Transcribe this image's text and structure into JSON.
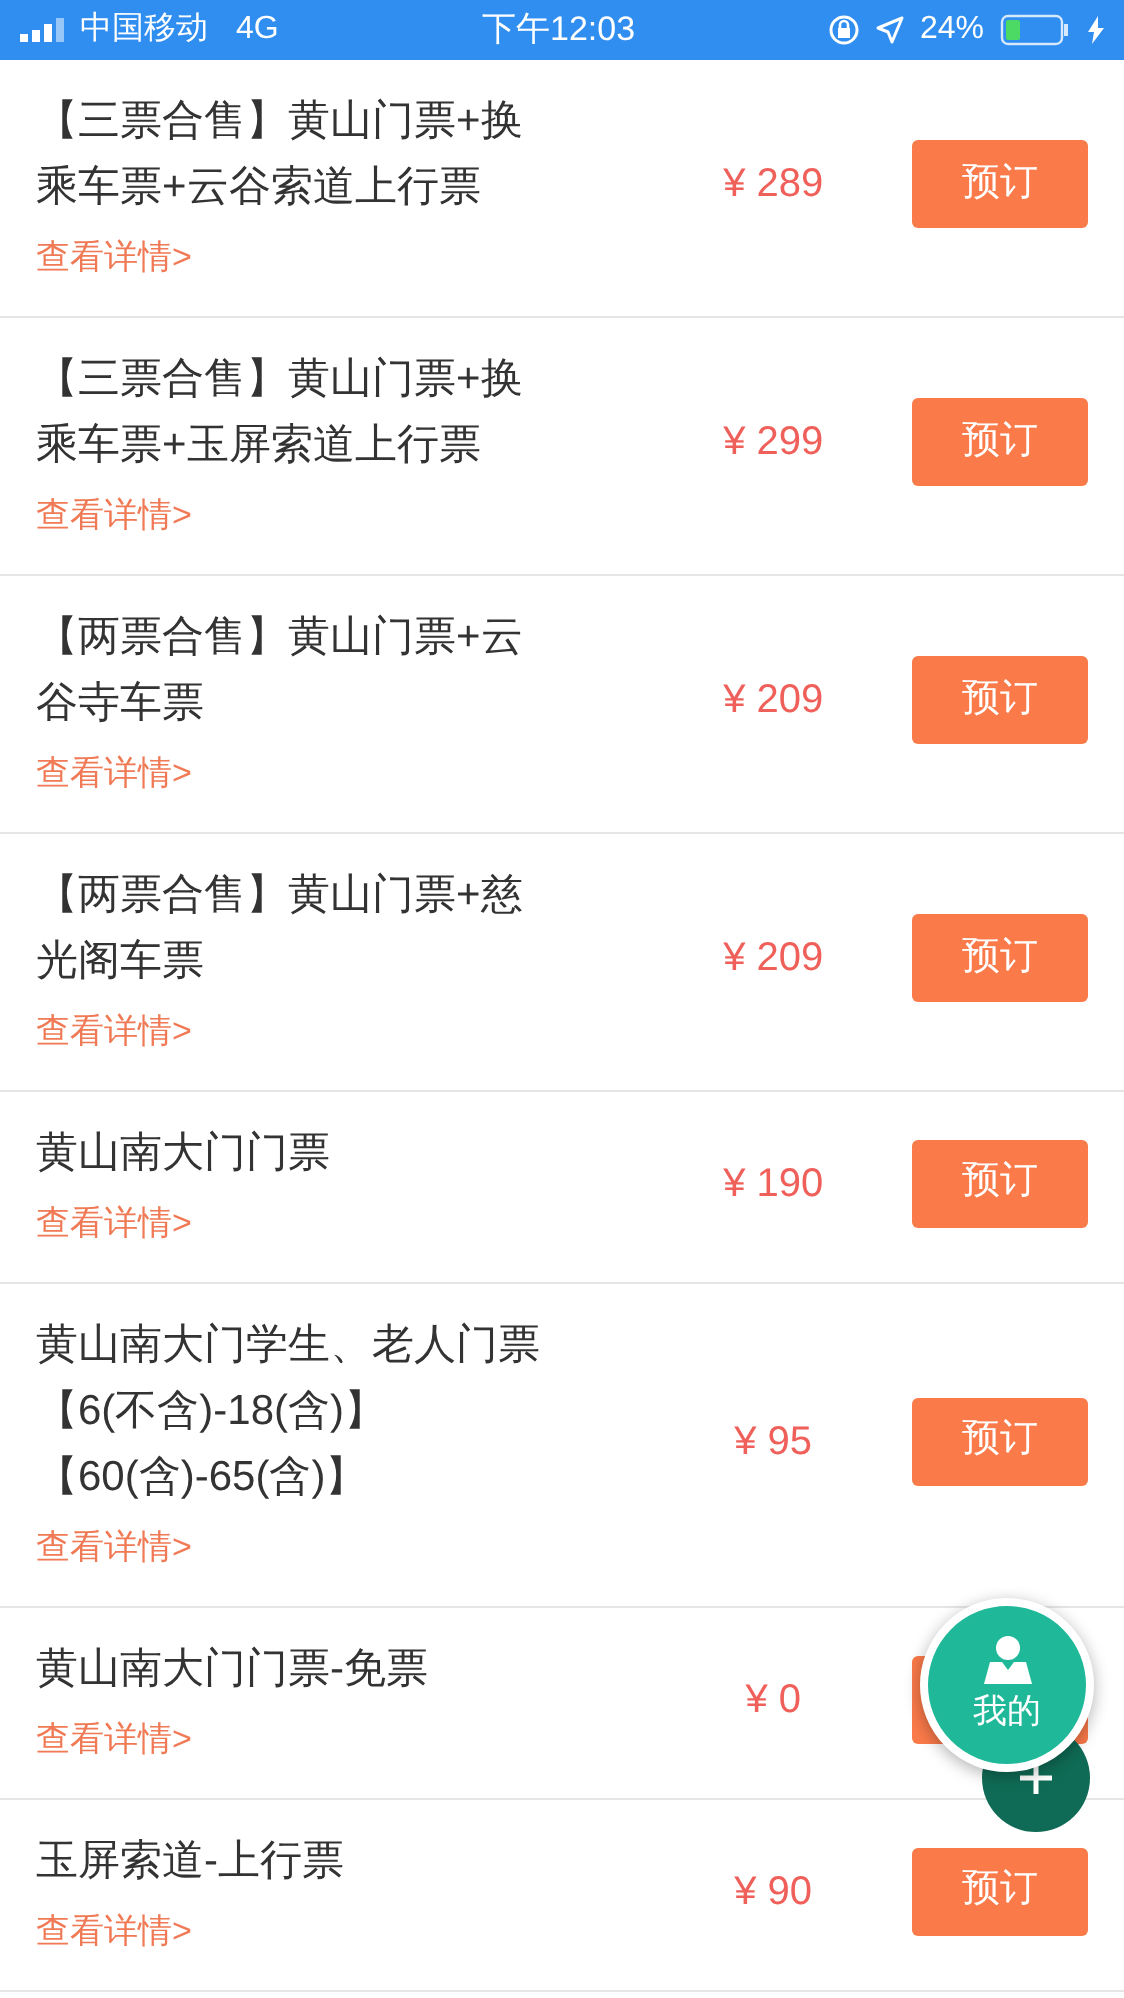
{
  "status_bar": {
    "carrier": "中国移动",
    "network": "4G",
    "time": "下午12:03",
    "battery": "24%"
  },
  "tickets": [
    {
      "title_lines": [
        "【三票合售】黄山门票+换",
        "乘车票+云谷索道上行票"
      ],
      "price": "¥ 289",
      "details": "查看详情>",
      "button": "预订"
    },
    {
      "title_lines": [
        "【三票合售】黄山门票+换",
        "乘车票+玉屏索道上行票"
      ],
      "price": "¥ 299",
      "details": "查看详情>",
      "button": "预订"
    },
    {
      "title_lines": [
        "【两票合售】黄山门票+云",
        "谷寺车票"
      ],
      "price": "¥ 209",
      "details": "查看详情>",
      "button": "预订"
    },
    {
      "title_lines": [
        "【两票合售】黄山门票+慈",
        "光阁车票"
      ],
      "price": "¥ 209",
      "details": "查看详情>",
      "button": "预订"
    },
    {
      "title_lines": [
        "黄山南大门门票"
      ],
      "price": "¥ 190",
      "details": "查看详情>",
      "button": "预订"
    },
    {
      "title_lines": [
        "黄山南大门学生、老人门票",
        "【6(不含)-18(含)】",
        "【60(含)-65(含)】"
      ],
      "price": "¥ 95",
      "details": "查看详情>",
      "button": "预订"
    },
    {
      "title_lines": [
        "黄山南大门门票-免票"
      ],
      "price": "¥ 0",
      "details": "查看详情>"
    },
    {
      "title_lines": [
        "玉屏索道-上行票"
      ],
      "price": "¥ 90",
      "details": "查看详情>",
      "button": "预订"
    }
  ],
  "fab": {
    "label": "我的"
  }
}
